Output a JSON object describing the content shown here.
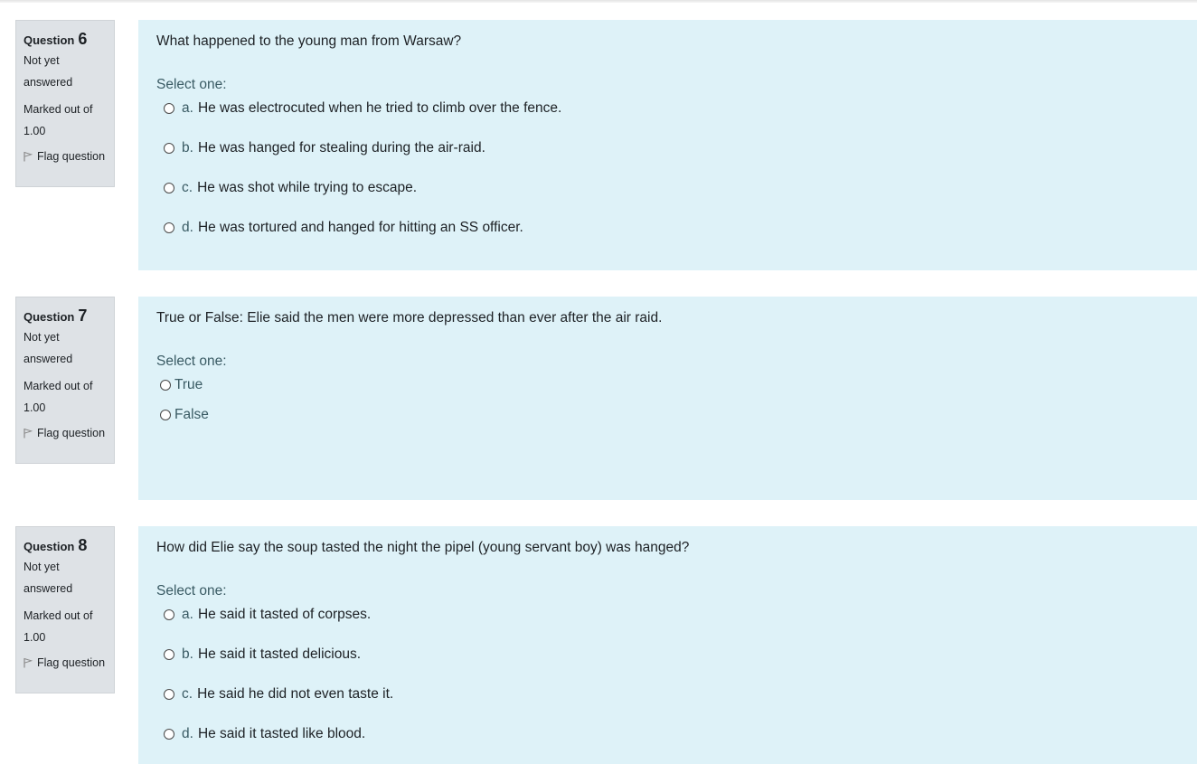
{
  "questions": [
    {
      "label": "Question",
      "number": "6",
      "state": [
        "Not yet",
        "answered"
      ],
      "grade": [
        "Marked out of",
        "1.00"
      ],
      "flag_label": "Flag question",
      "text": "What happened to the young man from Warsaw?",
      "prompt": "Select one:",
      "answers": [
        {
          "letter": "a.",
          "text": "He was electrocuted when he tried to climb over the fence."
        },
        {
          "letter": "b.",
          "text": "He was hanged for stealing during the air-raid."
        },
        {
          "letter": "c.",
          "text": "He was shot while trying to escape."
        },
        {
          "letter": "d.",
          "text": "He was tortured and hanged for hitting an SS officer."
        }
      ]
    },
    {
      "label": "Question",
      "number": "7",
      "state": [
        "Not yet",
        "answered"
      ],
      "grade": [
        "Marked out of",
        "1.00"
      ],
      "flag_label": "Flag question",
      "text": "True or False: Elie said the men were more depressed than ever after the air raid.",
      "prompt": "Select one:",
      "answers": [
        {
          "letter": "",
          "text": "True"
        },
        {
          "letter": "",
          "text": "False"
        }
      ]
    },
    {
      "label": "Question",
      "number": "8",
      "state": [
        "Not yet",
        "answered"
      ],
      "grade": [
        "Marked out of",
        "1.00"
      ],
      "flag_label": "Flag question",
      "text": "How did Elie say the soup tasted the night the pipel (young servant boy) was hanged?",
      "prompt": "Select one:",
      "answers": [
        {
          "letter": "a.",
          "text": "He said it tasted of corpses."
        },
        {
          "letter": "b.",
          "text": "He said it tasted delicious."
        },
        {
          "letter": "c.",
          "text": "He said he did not even taste it."
        },
        {
          "letter": "d.",
          "text": "He said it tasted like blood."
        }
      ]
    }
  ]
}
